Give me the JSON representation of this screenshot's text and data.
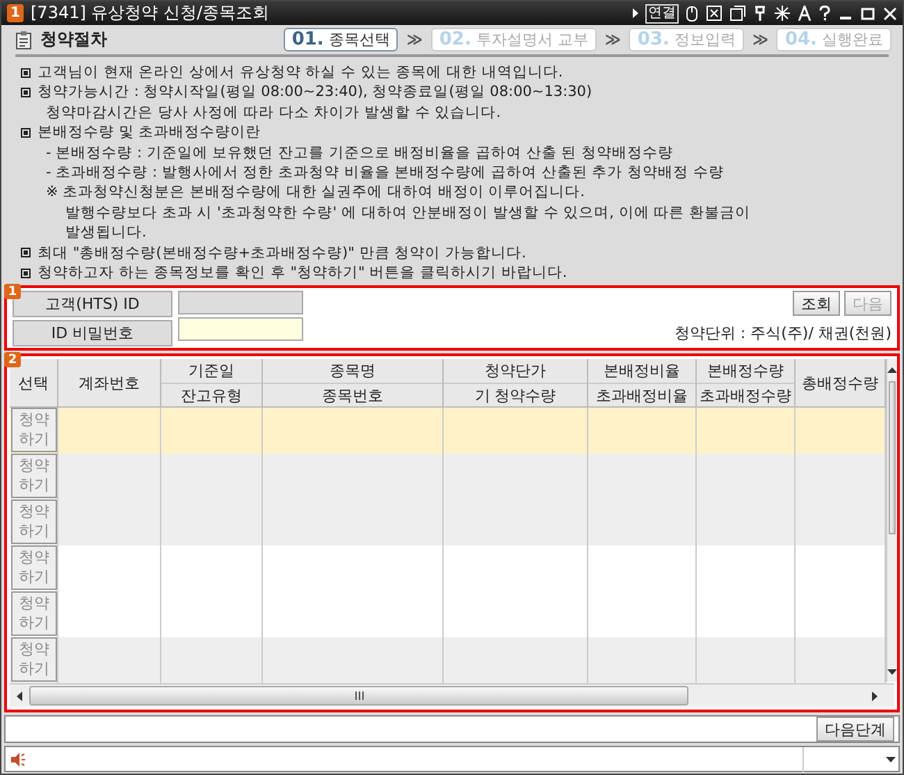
{
  "window": {
    "badge": "1",
    "title": "[7341] 유상청약 신청/종목조회",
    "toolbar_label": "연결"
  },
  "procedure": {
    "title": "청약절차",
    "steps": [
      {
        "number": "01.",
        "label": "종목선택",
        "selected": true
      },
      {
        "number": "02.",
        "label": "투자설명서 교부",
        "selected": false
      },
      {
        "number": "03.",
        "label": "정보입력",
        "selected": false
      },
      {
        "number": "04.",
        "label": "실행완료",
        "selected": false
      }
    ],
    "separator": "≫"
  },
  "notices": [
    {
      "kind": "bullet",
      "text": "고객님이 현재 온라인 상에서 유상청약 하실 수 있는 종목에 대한 내역입니다."
    },
    {
      "kind": "bullet",
      "text": "청약가능시간 : 청약시작일(평일 08:00~23:40), 청약종료일(평일 08:00~13:30)"
    },
    {
      "kind": "indent",
      "text": "청약마감시간은 당사 사정에 따라 다소 차이가 발생할 수 있습니다."
    },
    {
      "kind": "bullet",
      "text": "본배정수량 및 초과배정수량이란"
    },
    {
      "kind": "indent",
      "text": "- 본배정수량 : 기준일에 보유했던 잔고를 기준으로 배정비율을 곱하여 산출 된 청약배정수량"
    },
    {
      "kind": "indent",
      "text": "- 초과배정수량 : 발행사에서 정한 초과청약 비율을 본배정수량에 곱하여 산출된 추가 청약배정 수량"
    },
    {
      "kind": "indent",
      "text": "※ 초과청약신청분은 본배정수량에 대한 실권주에 대하여 배정이 이루어집니다."
    },
    {
      "kind": "indent2",
      "text": "발행수량보다 초과 시  '초과청약한 수량' 에 대하여 안분배정이 발생할 수 있으며, 이에 따른 환불금이"
    },
    {
      "kind": "indent2",
      "text": "발생됩니다."
    },
    {
      "kind": "bullet",
      "text": "최대  \"총배정수량(본배정수량+초과배정수량)\" 만큼 청약이 가능합니다."
    },
    {
      "kind": "bullet",
      "text": "청약하고자 하는 종목정보를 확인 후  \"청약하기\" 버튼을 클릭하시기 바랍니다."
    }
  ],
  "login": {
    "badge": "1",
    "id_label": "고객(HTS) ID",
    "password_label": "ID 비밀번호",
    "query_button": "조회",
    "next_button": {
      "label": "다음",
      "disabled": true
    },
    "unit_note": "청약단위 : 주식(주)/ 채권(천원)"
  },
  "table": {
    "badge": "2",
    "columns": [
      {
        "top": "선택"
      },
      {
        "top": "계좌번호"
      },
      {
        "top": "기준일",
        "bottom": "잔고유형"
      },
      {
        "top": "종목명",
        "bottom": "종목번호"
      },
      {
        "top": "청약단가",
        "bottom": "기 청약수량"
      },
      {
        "top": "본배정비율",
        "bottom": "초과배정비율"
      },
      {
        "top": "본배정수량",
        "bottom": "초과배정수량"
      },
      {
        "top": "총배정수량"
      }
    ],
    "rows": [
      {
        "button": "청약\n하기",
        "selected": true
      },
      {
        "button": "청약\n하기",
        "selected": false
      },
      {
        "button": "청약\n하기",
        "selected": false
      },
      {
        "button": "청약\n하기",
        "selected": false
      },
      {
        "button": "청약\n하기",
        "selected": false
      },
      {
        "button": "청약\n하기",
        "selected": false
      }
    ]
  },
  "next_step_button": "다음단계"
}
